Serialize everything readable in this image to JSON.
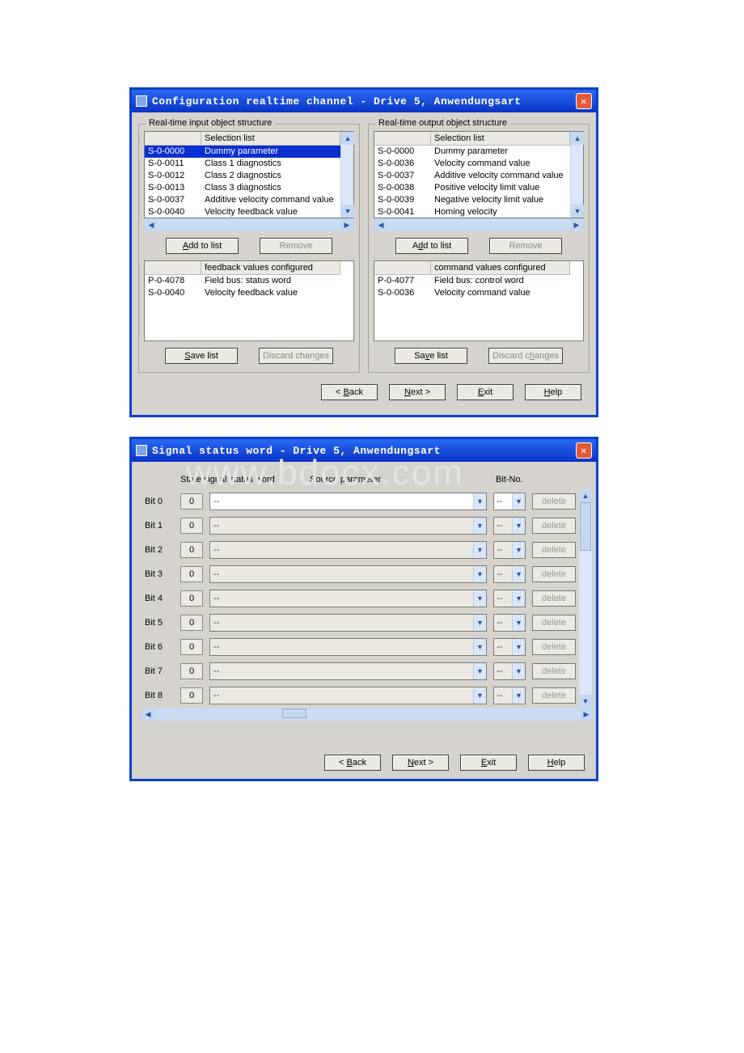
{
  "win1": {
    "title": "Configuration realtime channel - Drive 5,  Anwendungsart",
    "input_group": "Real-time input object structure",
    "output_group": "Real-time output object structure",
    "selection_hdr": "Selection list",
    "input_list": [
      {
        "code": "S-0-0000",
        "name": "Dummy parameter",
        "sel": true
      },
      {
        "code": "S-0-0011",
        "name": "Class 1 diagnostics",
        "sel": false
      },
      {
        "code": "S-0-0012",
        "name": "Class 2 diagnostics",
        "sel": false
      },
      {
        "code": "S-0-0013",
        "name": "Class 3 diagnostics",
        "sel": false
      },
      {
        "code": "S-0-0037",
        "name": "Additive velocity command value",
        "sel": false
      },
      {
        "code": "S-0-0040",
        "name": "Velocity feedback value",
        "sel": false
      }
    ],
    "output_list": [
      {
        "code": "S-0-0000",
        "name": "Dummy parameter"
      },
      {
        "code": "S-0-0036",
        "name": "Velocity command value"
      },
      {
        "code": "S-0-0037",
        "name": "Additive velocity command value"
      },
      {
        "code": "S-0-0038",
        "name": "Positive velocity limit value"
      },
      {
        "code": "S-0-0039",
        "name": "Negative velocity limit value"
      },
      {
        "code": "S-0-0041",
        "name": "Homing velocity"
      }
    ],
    "add_btn": "Add to list",
    "remove_btn": "Remove",
    "feedback_hdr": "feedback values configured",
    "command_hdr": "command values configured",
    "feedback_list": [
      {
        "code": "P-0-4078",
        "name": "Field bus: status word"
      },
      {
        "code": "S-0-0040",
        "name": "Velocity feedback value"
      }
    ],
    "command_list": [
      {
        "code": "P-0-4077",
        "name": "Field bus: control word"
      },
      {
        "code": "S-0-0036",
        "name": "Velocity command value"
      }
    ],
    "save_btn": "Save list",
    "discard_btn": "Discard changes"
  },
  "win2": {
    "title": "Signal status word - Drive 5,  Anwendungsart",
    "hdr_state": "State signal status word",
    "hdr_source": "Source parameter",
    "hdr_bitno": "Bit-No.",
    "delete_btn": "delete",
    "rows": [
      {
        "bit": "Bit 0",
        "state": "0",
        "src": "--",
        "no": "--",
        "enabled": true
      },
      {
        "bit": "Bit 1",
        "state": "0",
        "src": "--",
        "no": "--",
        "enabled": false
      },
      {
        "bit": "Bit 2",
        "state": "0",
        "src": "--",
        "no": "--",
        "enabled": false
      },
      {
        "bit": "Bit 3",
        "state": "0",
        "src": "--",
        "no": "--",
        "enabled": false
      },
      {
        "bit": "Bit 4",
        "state": "0",
        "src": "--",
        "no": "--",
        "enabled": false
      },
      {
        "bit": "Bit 5",
        "state": "0",
        "src": "--",
        "no": "--",
        "enabled": false
      },
      {
        "bit": "Bit 6",
        "state": "0",
        "src": "--",
        "no": "--",
        "enabled": false
      },
      {
        "bit": "Bit 7",
        "state": "0",
        "src": "--",
        "no": "--",
        "enabled": false
      },
      {
        "bit": "Bit 8",
        "state": "0",
        "src": "--",
        "no": "--",
        "enabled": false
      }
    ]
  },
  "nav": {
    "back": "< Back",
    "next": "Next >",
    "exit": "Exit",
    "help": "Help"
  },
  "watermark": "www.bdocx.com"
}
